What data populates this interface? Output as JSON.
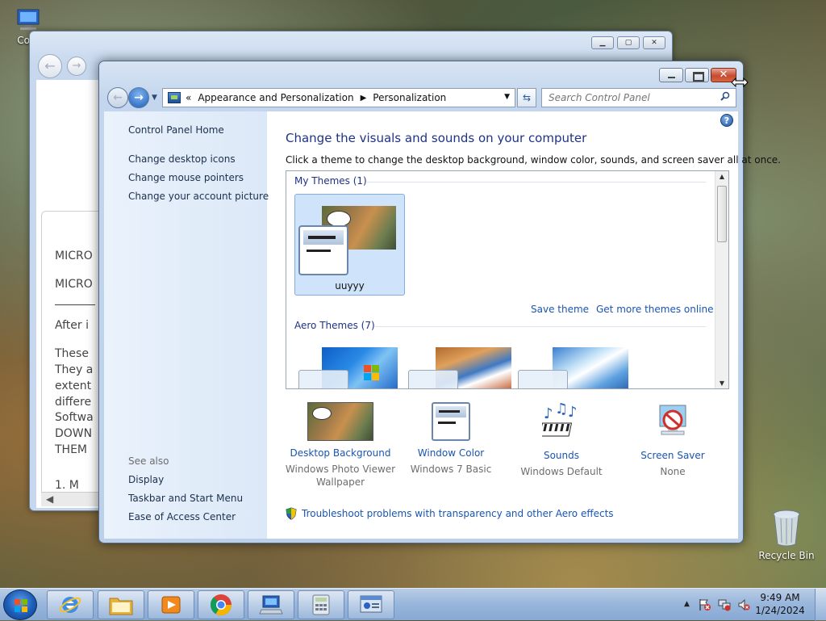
{
  "desktop": {
    "computer_label": "Com",
    "recycle_label": "Recycle Bin"
  },
  "back_window": {
    "lines": [
      "MICRO",
      "MICRO",
      "After i",
      "These",
      "They a",
      "extent",
      "differe",
      "Softwa",
      "DOWN",
      "THEM",
      "1.    M"
    ]
  },
  "window": {
    "address": {
      "chevron": "«",
      "crumb1": "Appearance and Personalization",
      "crumb2": "Personalization"
    },
    "search_placeholder": "Search Control Panel",
    "left_pane": {
      "links": [
        "Control Panel Home",
        "Change desktop icons",
        "Change mouse pointers",
        "Change your account picture"
      ],
      "see_also_title": "See also",
      "see_also_links": [
        "Display",
        "Taskbar and Start Menu",
        "Ease of Access Center"
      ]
    },
    "content": {
      "title": "Change the visuals and sounds on your computer",
      "description": "Click a theme to change the desktop background, window color, sounds, and screen saver all at once.",
      "my_themes_title": "My Themes (1)",
      "my_theme_name": "uuyyy",
      "save_theme": "Save theme",
      "get_more_themes": "Get more themes online",
      "aero_themes_title": "Aero Themes (7)",
      "bottom": [
        {
          "label": "Desktop Background",
          "sub": "Windows Photo Viewer Wallpaper"
        },
        {
          "label": "Window Color",
          "sub": "Windows 7 Basic"
        },
        {
          "label": "Sounds",
          "sub": "Windows Default"
        },
        {
          "label": "Screen Saver",
          "sub": "None"
        }
      ],
      "troubleshoot": "Troubleshoot problems with transparency and other Aero effects"
    }
  },
  "taskbar": {
    "time": "9:49 AM",
    "date": "1/24/2024",
    "pinned": [
      "internet-explorer",
      "file-explorer",
      "media-player",
      "chrome",
      "control-panel",
      "calculator",
      "network-settings"
    ]
  },
  "colors": {
    "link_blue": "#1a55b0",
    "heading_blue": "#1e3287",
    "close_red": "#c74a2f"
  }
}
